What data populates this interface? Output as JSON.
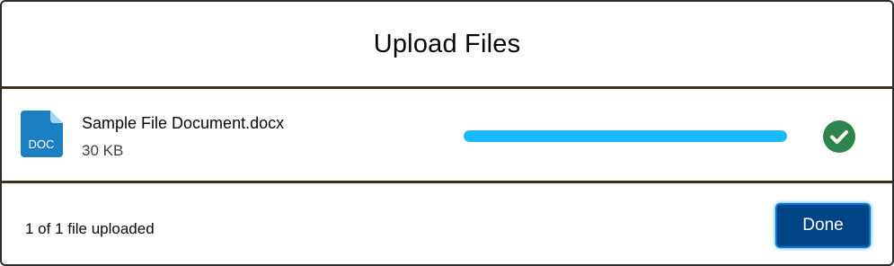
{
  "dialog": {
    "title": "Upload Files"
  },
  "file": {
    "name": "Sample File Document.docx",
    "size": "30 KB",
    "type_label": "DOC",
    "icon": "doc-file-icon",
    "progress_percent": 100,
    "status_icon": "success-check-icon"
  },
  "footer": {
    "status_text": "1 of 1 file uploaded",
    "done_label": "Done"
  },
  "colors": {
    "progress": "#1ab9ff",
    "success": "#2e844a",
    "brand_button": "#014486",
    "doc_icon": "#1b7fc1"
  }
}
